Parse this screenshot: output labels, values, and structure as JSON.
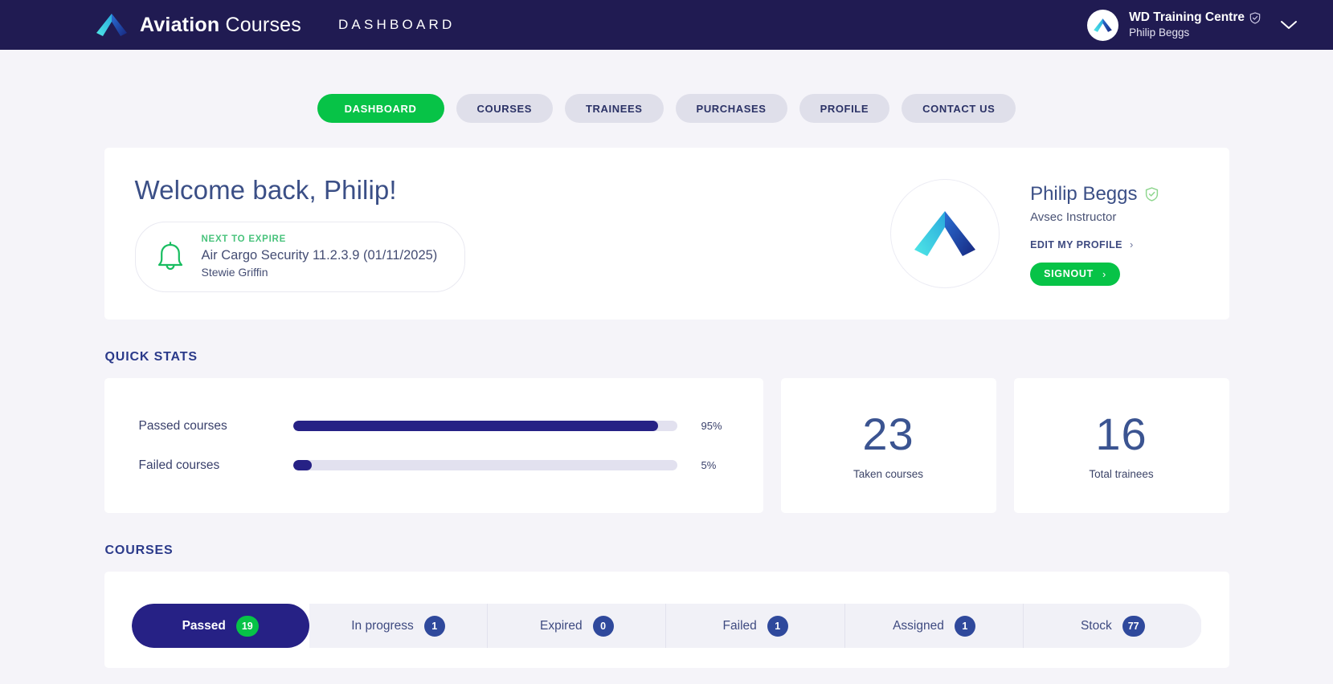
{
  "header": {
    "brand_bold": "Aviation",
    "brand_light": "Courses",
    "section": "DASHBOARD",
    "account_org": "WD Training Centre",
    "account_user": "Philip Beggs"
  },
  "nav": {
    "items": [
      {
        "label": "DASHBOARD",
        "active": true
      },
      {
        "label": "COURSES",
        "active": false
      },
      {
        "label": "TRAINEES",
        "active": false
      },
      {
        "label": "PURCHASES",
        "active": false
      },
      {
        "label": "PROFILE",
        "active": false
      },
      {
        "label": "CONTACT US",
        "active": false
      }
    ]
  },
  "welcome": {
    "title": "Welcome back, Philip!",
    "expire_kicker": "NEXT TO EXPIRE",
    "expire_course": "Air Cargo Security 11.2.3.9 (01/11/2025)",
    "expire_user": "Stewie Griffin",
    "profile_name": "Philip Beggs",
    "profile_role": "Avsec Instructor",
    "edit_profile": "EDIT MY PROFILE",
    "edit_arrow": "›",
    "signout": "SIGNOUT",
    "signout_arrow": "›"
  },
  "quick_stats": {
    "heading": "QUICK STATS",
    "bars": [
      {
        "label": "Passed courses",
        "percent": 95,
        "percent_label": "95%"
      },
      {
        "label": "Failed courses",
        "percent": 5,
        "percent_label": "5%"
      }
    ],
    "cards": [
      {
        "value": "23",
        "caption": "Taken courses"
      },
      {
        "value": "16",
        "caption": "Total trainees"
      }
    ]
  },
  "courses": {
    "heading": "COURSES",
    "tabs": [
      {
        "label": "Passed",
        "count": "19",
        "active": true
      },
      {
        "label": "In progress",
        "count": "1",
        "active": false
      },
      {
        "label": "Expired",
        "count": "0",
        "active": false
      },
      {
        "label": "Failed",
        "count": "1",
        "active": false
      },
      {
        "label": "Assigned",
        "count": "1",
        "active": false
      },
      {
        "label": "Stock",
        "count": "77",
        "active": false
      }
    ]
  },
  "colors": {
    "navy": "#201b52",
    "deep_blue": "#262185",
    "green": "#07c347",
    "badge_blue": "#2f499c",
    "page_bg": "#f5f4f9"
  }
}
